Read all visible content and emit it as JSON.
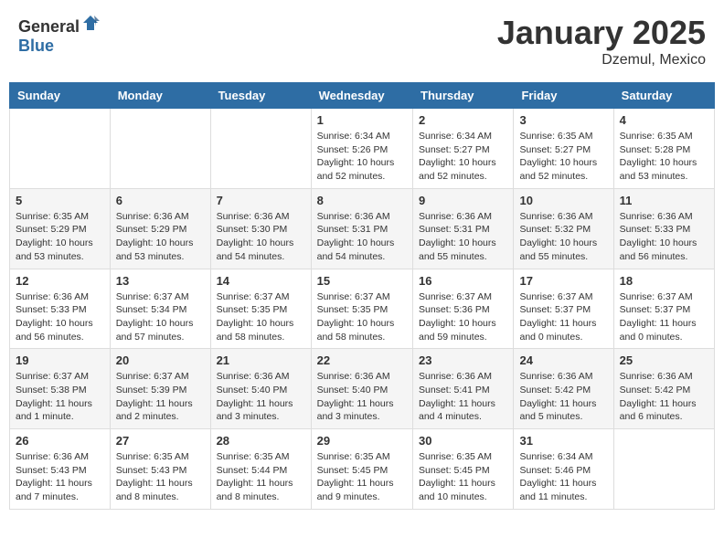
{
  "header": {
    "logo_general": "General",
    "logo_blue": "Blue",
    "month": "January 2025",
    "location": "Dzemul, Mexico"
  },
  "days_of_week": [
    "Sunday",
    "Monday",
    "Tuesday",
    "Wednesday",
    "Thursday",
    "Friday",
    "Saturday"
  ],
  "weeks": [
    [
      {
        "day": "",
        "info": ""
      },
      {
        "day": "",
        "info": ""
      },
      {
        "day": "",
        "info": ""
      },
      {
        "day": "1",
        "info": "Sunrise: 6:34 AM\nSunset: 5:26 PM\nDaylight: 10 hours\nand 52 minutes."
      },
      {
        "day": "2",
        "info": "Sunrise: 6:34 AM\nSunset: 5:27 PM\nDaylight: 10 hours\nand 52 minutes."
      },
      {
        "day": "3",
        "info": "Sunrise: 6:35 AM\nSunset: 5:27 PM\nDaylight: 10 hours\nand 52 minutes."
      },
      {
        "day": "4",
        "info": "Sunrise: 6:35 AM\nSunset: 5:28 PM\nDaylight: 10 hours\nand 53 minutes."
      }
    ],
    [
      {
        "day": "5",
        "info": "Sunrise: 6:35 AM\nSunset: 5:29 PM\nDaylight: 10 hours\nand 53 minutes."
      },
      {
        "day": "6",
        "info": "Sunrise: 6:36 AM\nSunset: 5:29 PM\nDaylight: 10 hours\nand 53 minutes."
      },
      {
        "day": "7",
        "info": "Sunrise: 6:36 AM\nSunset: 5:30 PM\nDaylight: 10 hours\nand 54 minutes."
      },
      {
        "day": "8",
        "info": "Sunrise: 6:36 AM\nSunset: 5:31 PM\nDaylight: 10 hours\nand 54 minutes."
      },
      {
        "day": "9",
        "info": "Sunrise: 6:36 AM\nSunset: 5:31 PM\nDaylight: 10 hours\nand 55 minutes."
      },
      {
        "day": "10",
        "info": "Sunrise: 6:36 AM\nSunset: 5:32 PM\nDaylight: 10 hours\nand 55 minutes."
      },
      {
        "day": "11",
        "info": "Sunrise: 6:36 AM\nSunset: 5:33 PM\nDaylight: 10 hours\nand 56 minutes."
      }
    ],
    [
      {
        "day": "12",
        "info": "Sunrise: 6:36 AM\nSunset: 5:33 PM\nDaylight: 10 hours\nand 56 minutes."
      },
      {
        "day": "13",
        "info": "Sunrise: 6:37 AM\nSunset: 5:34 PM\nDaylight: 10 hours\nand 57 minutes."
      },
      {
        "day": "14",
        "info": "Sunrise: 6:37 AM\nSunset: 5:35 PM\nDaylight: 10 hours\nand 58 minutes."
      },
      {
        "day": "15",
        "info": "Sunrise: 6:37 AM\nSunset: 5:35 PM\nDaylight: 10 hours\nand 58 minutes."
      },
      {
        "day": "16",
        "info": "Sunrise: 6:37 AM\nSunset: 5:36 PM\nDaylight: 10 hours\nand 59 minutes."
      },
      {
        "day": "17",
        "info": "Sunrise: 6:37 AM\nSunset: 5:37 PM\nDaylight: 11 hours\nand 0 minutes."
      },
      {
        "day": "18",
        "info": "Sunrise: 6:37 AM\nSunset: 5:37 PM\nDaylight: 11 hours\nand 0 minutes."
      }
    ],
    [
      {
        "day": "19",
        "info": "Sunrise: 6:37 AM\nSunset: 5:38 PM\nDaylight: 11 hours\nand 1 minute."
      },
      {
        "day": "20",
        "info": "Sunrise: 6:37 AM\nSunset: 5:39 PM\nDaylight: 11 hours\nand 2 minutes."
      },
      {
        "day": "21",
        "info": "Sunrise: 6:36 AM\nSunset: 5:40 PM\nDaylight: 11 hours\nand 3 minutes."
      },
      {
        "day": "22",
        "info": "Sunrise: 6:36 AM\nSunset: 5:40 PM\nDaylight: 11 hours\nand 3 minutes."
      },
      {
        "day": "23",
        "info": "Sunrise: 6:36 AM\nSunset: 5:41 PM\nDaylight: 11 hours\nand 4 minutes."
      },
      {
        "day": "24",
        "info": "Sunrise: 6:36 AM\nSunset: 5:42 PM\nDaylight: 11 hours\nand 5 minutes."
      },
      {
        "day": "25",
        "info": "Sunrise: 6:36 AM\nSunset: 5:42 PM\nDaylight: 11 hours\nand 6 minutes."
      }
    ],
    [
      {
        "day": "26",
        "info": "Sunrise: 6:36 AM\nSunset: 5:43 PM\nDaylight: 11 hours\nand 7 minutes."
      },
      {
        "day": "27",
        "info": "Sunrise: 6:35 AM\nSunset: 5:43 PM\nDaylight: 11 hours\nand 8 minutes."
      },
      {
        "day": "28",
        "info": "Sunrise: 6:35 AM\nSunset: 5:44 PM\nDaylight: 11 hours\nand 8 minutes."
      },
      {
        "day": "29",
        "info": "Sunrise: 6:35 AM\nSunset: 5:45 PM\nDaylight: 11 hours\nand 9 minutes."
      },
      {
        "day": "30",
        "info": "Sunrise: 6:35 AM\nSunset: 5:45 PM\nDaylight: 11 hours\nand 10 minutes."
      },
      {
        "day": "31",
        "info": "Sunrise: 6:34 AM\nSunset: 5:46 PM\nDaylight: 11 hours\nand 11 minutes."
      },
      {
        "day": "",
        "info": ""
      }
    ]
  ]
}
